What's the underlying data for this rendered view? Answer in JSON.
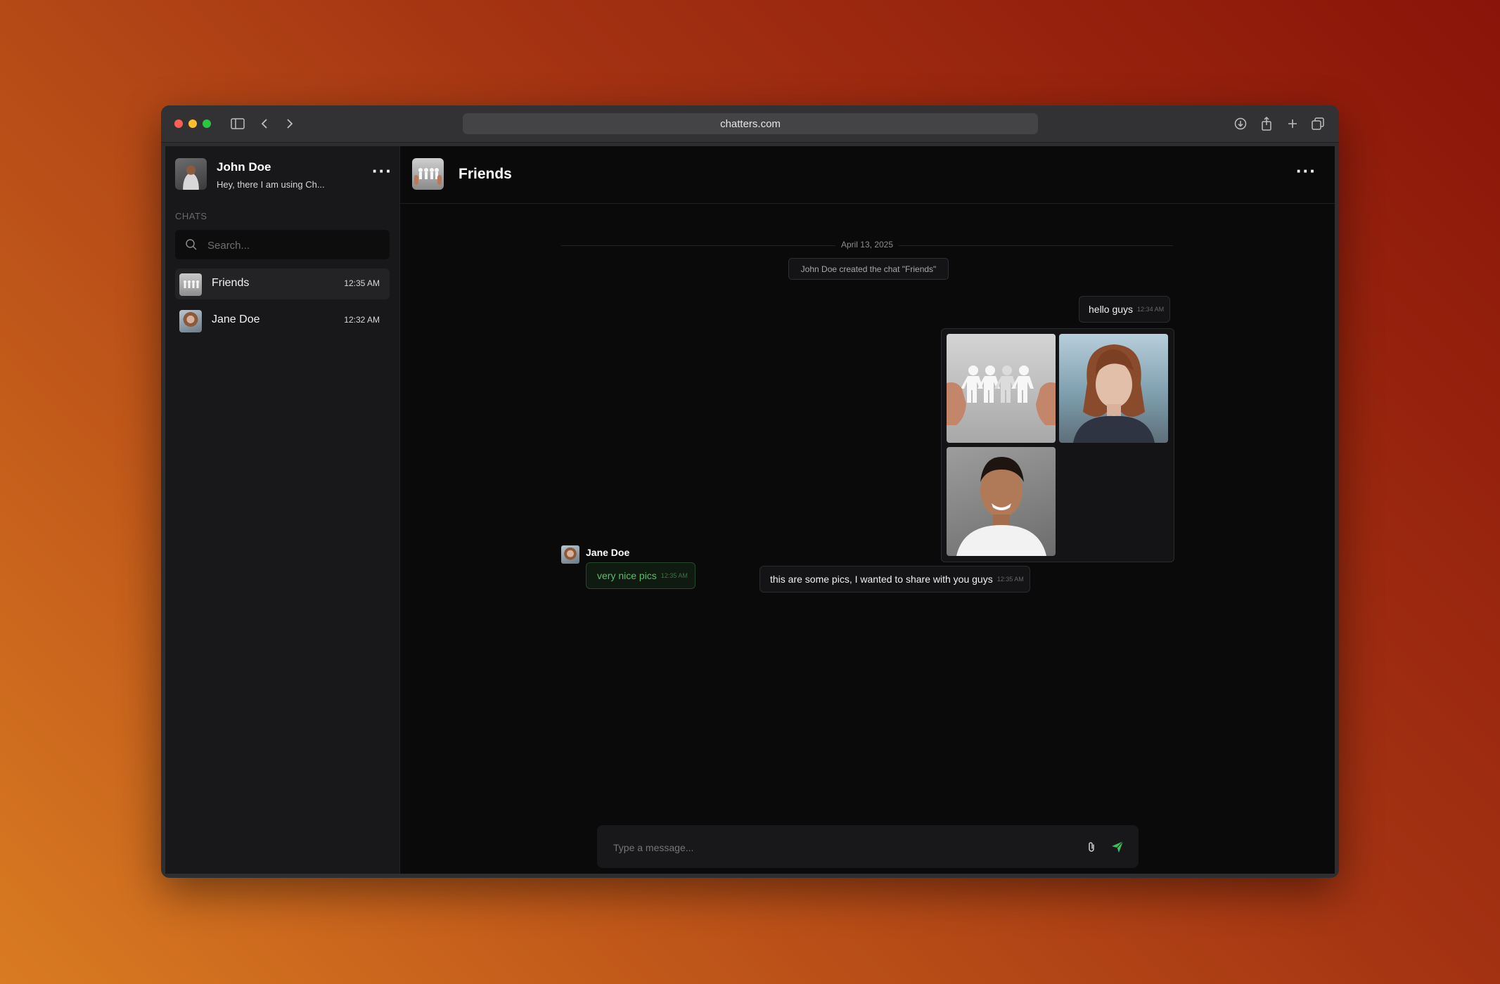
{
  "browser": {
    "url": "chatters.com"
  },
  "sidebar": {
    "profile": {
      "name": "John Doe",
      "status": "Hey, there I am using Ch..."
    },
    "section_label": "CHATS",
    "search": {
      "placeholder": "Search..."
    },
    "chats": [
      {
        "name": "Friends",
        "time": "12:35 AM",
        "active": true
      },
      {
        "name": "Jane Doe",
        "time": "12:32 AM",
        "active": false
      }
    ]
  },
  "chat": {
    "title": "Friends",
    "date_separator": "April 13, 2025",
    "system_message": "John Doe created the chat \"Friends\"",
    "messages": [
      {
        "direction": "out",
        "text": "hello guys",
        "time": "12:34 AM"
      },
      {
        "direction": "out",
        "type": "images",
        "images": [
          "paper-people-chain-photo",
          "red-haired-woman-portrait",
          "smiling-man-portrait"
        ]
      },
      {
        "direction": "out",
        "text": "this are some pics, I wanted to share with you guys",
        "time": "12:35 AM"
      },
      {
        "direction": "in",
        "sender": "Jane Doe",
        "text": "very nice pics",
        "time": "12:35 AM"
      }
    ],
    "composer": {
      "placeholder": "Type a message..."
    }
  },
  "colors": {
    "accent_green": "#58c06a",
    "send_icon": "#3fbf5b"
  }
}
